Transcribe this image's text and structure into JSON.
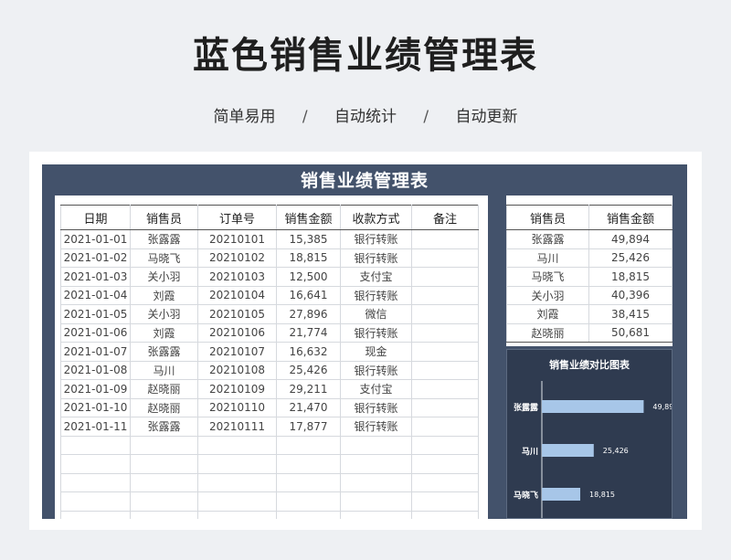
{
  "header": {
    "title": "蓝色销售业绩管理表",
    "tags": [
      "简单易用",
      "自动统计",
      "自动更新"
    ],
    "separator": "/"
  },
  "sheet": {
    "title": "销售业绩管理表"
  },
  "records": {
    "columns": [
      "日期",
      "销售员",
      "订单号",
      "销售金额",
      "收款方式",
      "备注"
    ],
    "rows": [
      [
        "2021-01-01",
        "张露露",
        "20210101",
        "15,385",
        "银行转账",
        ""
      ],
      [
        "2021-01-02",
        "马晓飞",
        "20210102",
        "18,815",
        "银行转账",
        ""
      ],
      [
        "2021-01-03",
        "关小羽",
        "20210103",
        "12,500",
        "支付宝",
        ""
      ],
      [
        "2021-01-04",
        "刘霞",
        "20210104",
        "16,641",
        "银行转账",
        ""
      ],
      [
        "2021-01-05",
        "关小羽",
        "20210105",
        "27,896",
        "微信",
        ""
      ],
      [
        "2021-01-06",
        "刘霞",
        "20210106",
        "21,774",
        "银行转账",
        ""
      ],
      [
        "2021-01-07",
        "张露露",
        "20210107",
        "16,632",
        "现金",
        ""
      ],
      [
        "2021-01-08",
        "马川",
        "20210108",
        "25,426",
        "银行转账",
        ""
      ],
      [
        "2021-01-09",
        "赵晓丽",
        "20210109",
        "29,211",
        "支付宝",
        ""
      ],
      [
        "2021-01-10",
        "赵晓丽",
        "20210110",
        "21,470",
        "银行转账",
        ""
      ],
      [
        "2021-01-11",
        "张露露",
        "20210111",
        "17,877",
        "银行转账",
        ""
      ]
    ],
    "empty_rows": 5
  },
  "summary": {
    "columns": [
      "销售员",
      "销售金额"
    ],
    "rows": [
      [
        "张露露",
        "49,894"
      ],
      [
        "马川",
        "25,426"
      ],
      [
        "马晓飞",
        "18,815"
      ],
      [
        "关小羽",
        "40,396"
      ],
      [
        "刘霞",
        "38,415"
      ],
      [
        "赵晓丽",
        "50,681"
      ]
    ]
  },
  "chart_data": {
    "type": "bar",
    "orientation": "horizontal",
    "title": "销售业绩对比图表",
    "categories": [
      "张露露",
      "马川",
      "马晓飞"
    ],
    "values": [
      49894,
      25426,
      18815
    ],
    "data_labels": [
      "49,894",
      "25,426",
      "18,815"
    ],
    "xlim": [
      0,
      60000
    ],
    "grid": false,
    "legend": "none",
    "bar_color": "#a7c6e8",
    "background_color": "#2f3b50",
    "text_color": "#ffffff"
  }
}
